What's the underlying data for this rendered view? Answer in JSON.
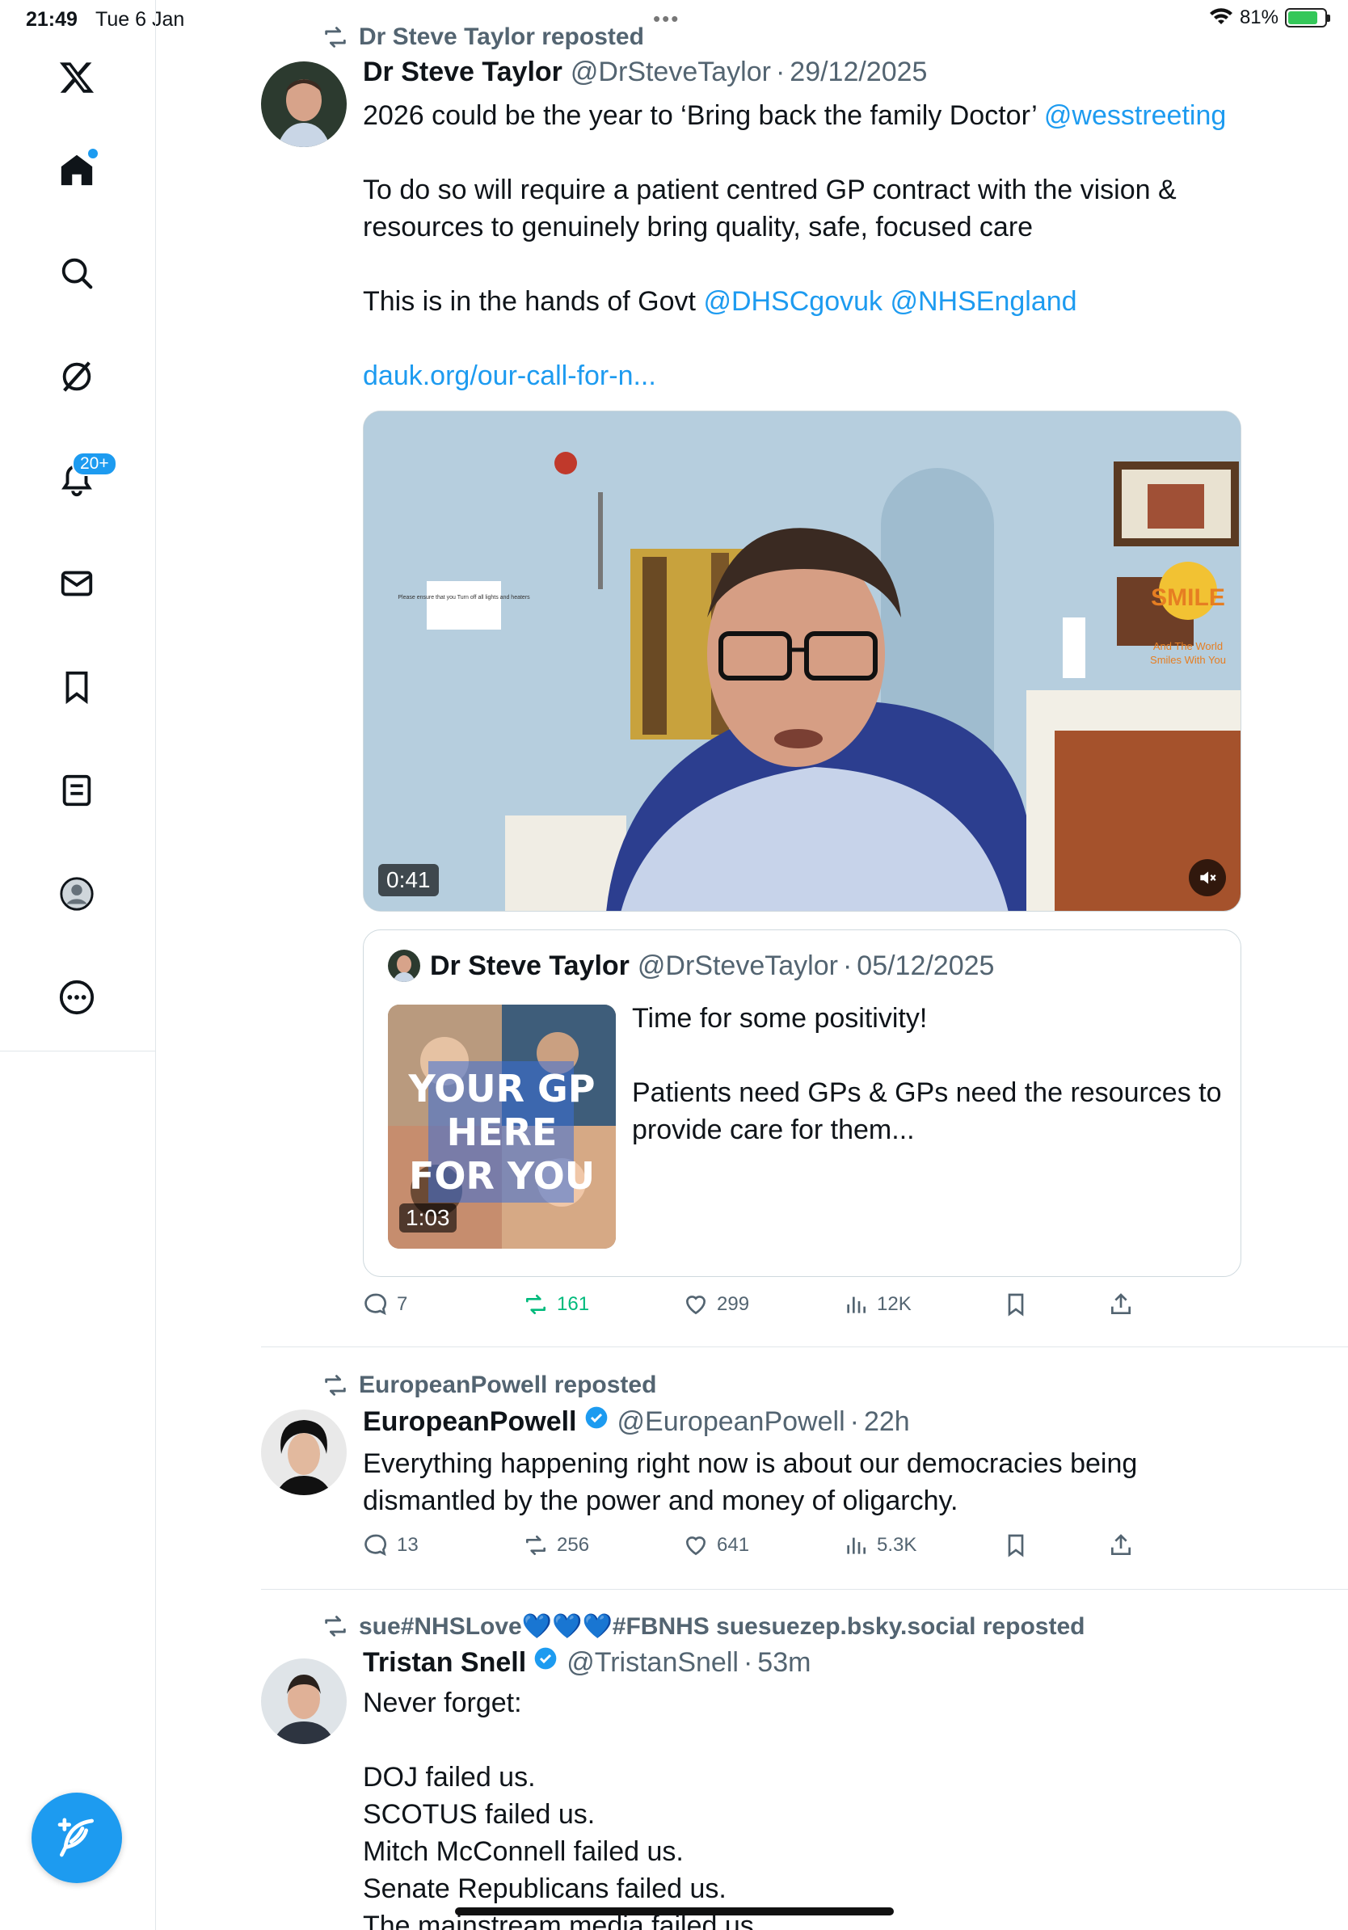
{
  "status_bar": {
    "time": "21:49",
    "date": "Tue 6 Jan",
    "battery": "81%",
    "battery_level": 0.81
  },
  "sidebar": {
    "items": [
      {
        "name": "x-logo"
      },
      {
        "name": "home"
      },
      {
        "name": "search"
      },
      {
        "name": "grok"
      },
      {
        "name": "notifications",
        "badge": "20+"
      },
      {
        "name": "messages"
      },
      {
        "name": "bookmarks"
      },
      {
        "name": "lists"
      },
      {
        "name": "profile"
      },
      {
        "name": "more"
      }
    ],
    "compose_icon": "feather-plus-icon"
  },
  "colors": {
    "accent": "#1d9bf0",
    "retweet_active": "#00ba7c",
    "secondary_text": "#536471"
  },
  "tweets": [
    {
      "repost_by": "Dr Steve Taylor reposted",
      "name": "Dr Steve Taylor",
      "handle": "@DrSteveTaylor",
      "sep": "·",
      "date": "29/12/2025",
      "body": {
        "l1": "2026 could be the year to ‘Bring back the family Doctor’ ",
        "l1_mention": "@wesstreeting",
        "l2": "To do so will require a patient centred GP contract with the vision &",
        "l3": "resources to genuinely bring quality, safe, focused care",
        "l4": "This is in the hands of Govt ",
        "l4_mention1": "@DHSCgovuk",
        "l4_mention2": "@NHSEngland",
        "l5_link": "dauk.org/our-call-for-n..."
      },
      "media": {
        "duration": "0:41",
        "wall_sign": "Please ensure that you Turn off all lights and heaters",
        "poster_text": "SMILE",
        "poster_sub1": "And The World",
        "poster_sub2": "Smiles With You"
      },
      "quote": {
        "name": "Dr Steve Taylor",
        "handle": "@DrSteveTaylor",
        "sep": "·",
        "date": "05/12/2025",
        "thumb_lines": [
          "YOUR GP",
          "HERE",
          "FOR YOU"
        ],
        "thumb_duration": "1:03",
        "text1": "Time for some positivity!",
        "text2": "Patients need GPs & GPs need the resources to",
        "text3": "provide care for them..."
      },
      "actions": {
        "replies": "7",
        "reposts": "161",
        "likes": "299",
        "views": "12K"
      }
    },
    {
      "repost_by": "EuropeanPowell reposted",
      "name": "EuropeanPowell",
      "handle": "@EuropeanPowell",
      "sep": "·",
      "date": "22h",
      "body": {
        "l1": "Everything happening right now is about our democracies being",
        "l2": "dismantled by the power and money of oligarchy."
      },
      "actions": {
        "replies": "13",
        "reposts": "256",
        "likes": "641",
        "views": "5.3K"
      }
    },
    {
      "repost_by": "sue#NHSLove💙💙💙#FBNHS suesuezep.bsky.social reposted",
      "name": "Tristan Snell",
      "handle": "@TristanSnell",
      "sep": "·",
      "date": "53m",
      "body": {
        "l1": "Never forget:",
        "l2": "DOJ failed us.",
        "l3": "SCOTUS failed us.",
        "l4": "Mitch McConnell failed us.",
        "l5": "Senate Republicans failed us.",
        "l6": "The mainstream media failed us."
      }
    }
  ]
}
